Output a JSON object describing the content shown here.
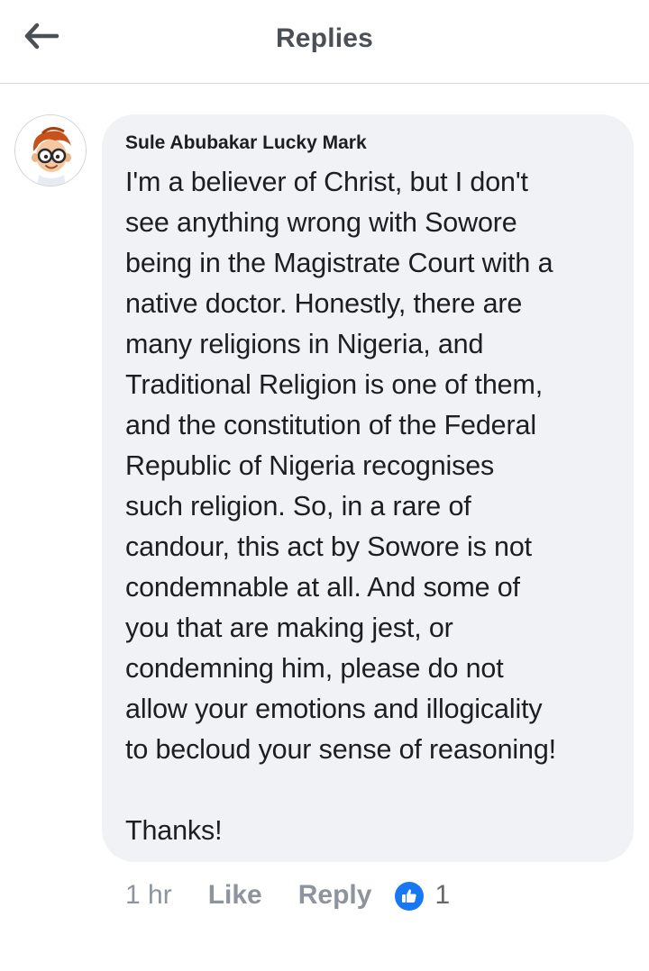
{
  "header": {
    "title": "Replies",
    "back_icon": "arrow-left-icon"
  },
  "comment": {
    "author": "Sule Abubakar Lucky Mark",
    "avatar_icon": "cartoon-boy-avatar",
    "text": "I'm a believer of Christ, but I don't\nsee anything wrong with Sowore\nbeing in the Magistrate Court with a\nnative doctor. Honestly, there are\nmany religions in Nigeria, and\nTraditional Religion is one of them,\nand the constitution of the Federal\nRepublic of Nigeria recognises\nsuch religion. So, in a rare of\ncandour, this act by Sowore is not\ncondemnable at all. And some of\nyou that are making jest, or\ncondemning him, please do not\nallow your emotions and illogicality\nto becloud your sense of reasoning!\n\nThanks!",
    "time": "1 hr",
    "like_label": "Like",
    "reply_label": "Reply",
    "reaction_icon": "thumbs-up-icon",
    "reaction_count": "1"
  },
  "colors": {
    "bubble_bg": "#f0f2f5",
    "like_blue": "#1877f2",
    "meta_gray": "#8d949e",
    "header_text": "#4b4f56"
  }
}
